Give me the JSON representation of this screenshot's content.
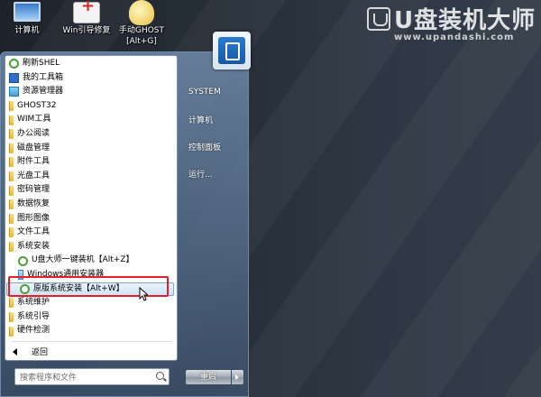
{
  "desktop": {
    "icons": [
      {
        "label": "计算机"
      },
      {
        "label": "Win引导修复"
      },
      {
        "label": "手动GHOST",
        "label2": "[Alt+G]"
      }
    ]
  },
  "watermark": {
    "title": "U盘装机大师",
    "url": "www.upandashi.com"
  },
  "start_menu": {
    "programs": [
      {
        "label": "刷新SHEL",
        "icon": "refresh-icon",
        "indent": false
      },
      {
        "label": "我的工具箱",
        "icon": "toolbox-icon",
        "indent": false
      },
      {
        "label": "资源管理器",
        "icon": "explorer-icon",
        "indent": false
      },
      {
        "label": "GHOST32",
        "icon": "folder-icon",
        "indent": false
      },
      {
        "label": "WIM工具",
        "icon": "folder-icon",
        "indent": false
      },
      {
        "label": "办公阅读",
        "icon": "folder-icon",
        "indent": false
      },
      {
        "label": "磁盘管理",
        "icon": "folder-icon",
        "indent": false
      },
      {
        "label": "附件工具",
        "icon": "folder-icon",
        "indent": false
      },
      {
        "label": "光盘工具",
        "icon": "folder-icon",
        "indent": false
      },
      {
        "label": "密码管理",
        "icon": "folder-icon",
        "indent": false
      },
      {
        "label": "数据恢复",
        "icon": "folder-icon",
        "indent": false
      },
      {
        "label": "图形图像",
        "icon": "folder-icon",
        "indent": false
      },
      {
        "label": "文件工具",
        "icon": "folder-icon",
        "indent": false
      },
      {
        "label": "系统安装",
        "icon": "folder-icon",
        "indent": false
      },
      {
        "label": "U盘大师一键装机【Alt+Z】",
        "icon": "refresh-icon",
        "indent": true
      },
      {
        "label": "Windows通用安装器",
        "icon": "installer-icon",
        "indent": true
      },
      {
        "label": "原版系统安装【Alt+W】",
        "icon": "refresh-icon",
        "indent": true,
        "selected": true
      },
      {
        "label": "系统维护",
        "icon": "folder-icon",
        "indent": false
      },
      {
        "label": "系统引导",
        "icon": "folder-icon",
        "indent": false
      },
      {
        "label": "硬件检测",
        "icon": "folder-icon",
        "indent": false
      }
    ],
    "back_label": "返回",
    "search_placeholder": "搜索程序和文件",
    "right_items": [
      "SYSTEM",
      "计算机",
      "控制面板",
      "运行..."
    ],
    "shutdown_label": "重启"
  }
}
